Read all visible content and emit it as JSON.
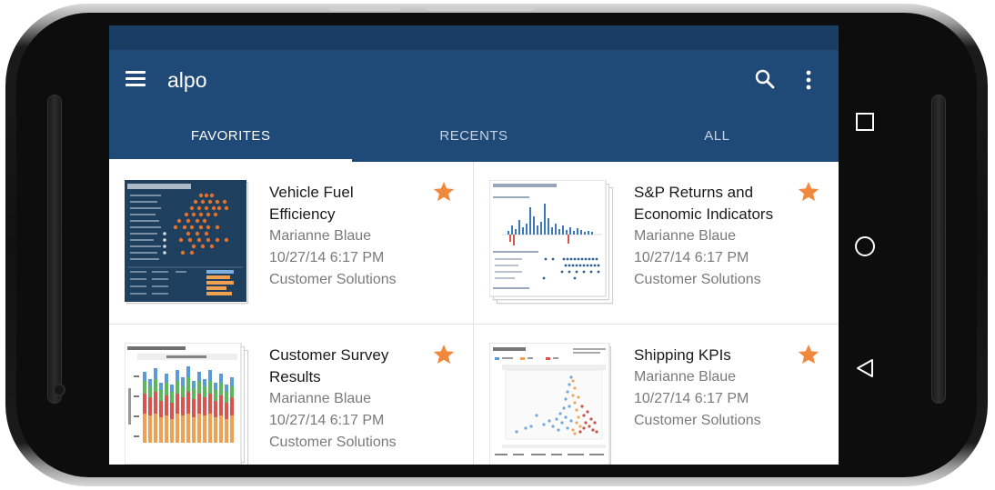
{
  "app": {
    "title": "alpo"
  },
  "toolbar": {
    "search_icon": "search-icon",
    "more_icon": "more-vert-icon"
  },
  "tabs": [
    {
      "label": "FAVORITES",
      "active": true
    },
    {
      "label": "RECENTS",
      "active": false
    },
    {
      "label": "ALL",
      "active": false
    }
  ],
  "cards": [
    {
      "title_lines": [
        "Vehicle Fuel",
        "Efficiency"
      ],
      "author": "Marianne Blaue",
      "date": "10/27/14 6:17 PM",
      "project": "Customer Solutions",
      "favorite": true
    },
    {
      "title_lines": [
        "S&P Returns and",
        "Economic Indicators"
      ],
      "author": "Marianne Blaue",
      "date": "10/27/14 6:17 PM",
      "project": "Customer Solutions",
      "favorite": true
    },
    {
      "title_lines": [
        "Customer Survey",
        "Results"
      ],
      "author": "Marianne Blaue",
      "date": "10/27/14 6:17 PM",
      "project": "Customer Solutions",
      "favorite": true
    },
    {
      "title_lines": [
        "Shipping KPIs"
      ],
      "author": "Marianne Blaue",
      "date": "10/27/14 6:17 PM",
      "project": "Customer Solutions",
      "favorite": true
    }
  ],
  "nav": {
    "square": "recent-apps-icon",
    "circle": "home-icon",
    "triangle": "back-icon"
  },
  "colors": {
    "appbar": "#1f4a78",
    "statusbar": "#1a3d63",
    "star": "#f0883e"
  }
}
